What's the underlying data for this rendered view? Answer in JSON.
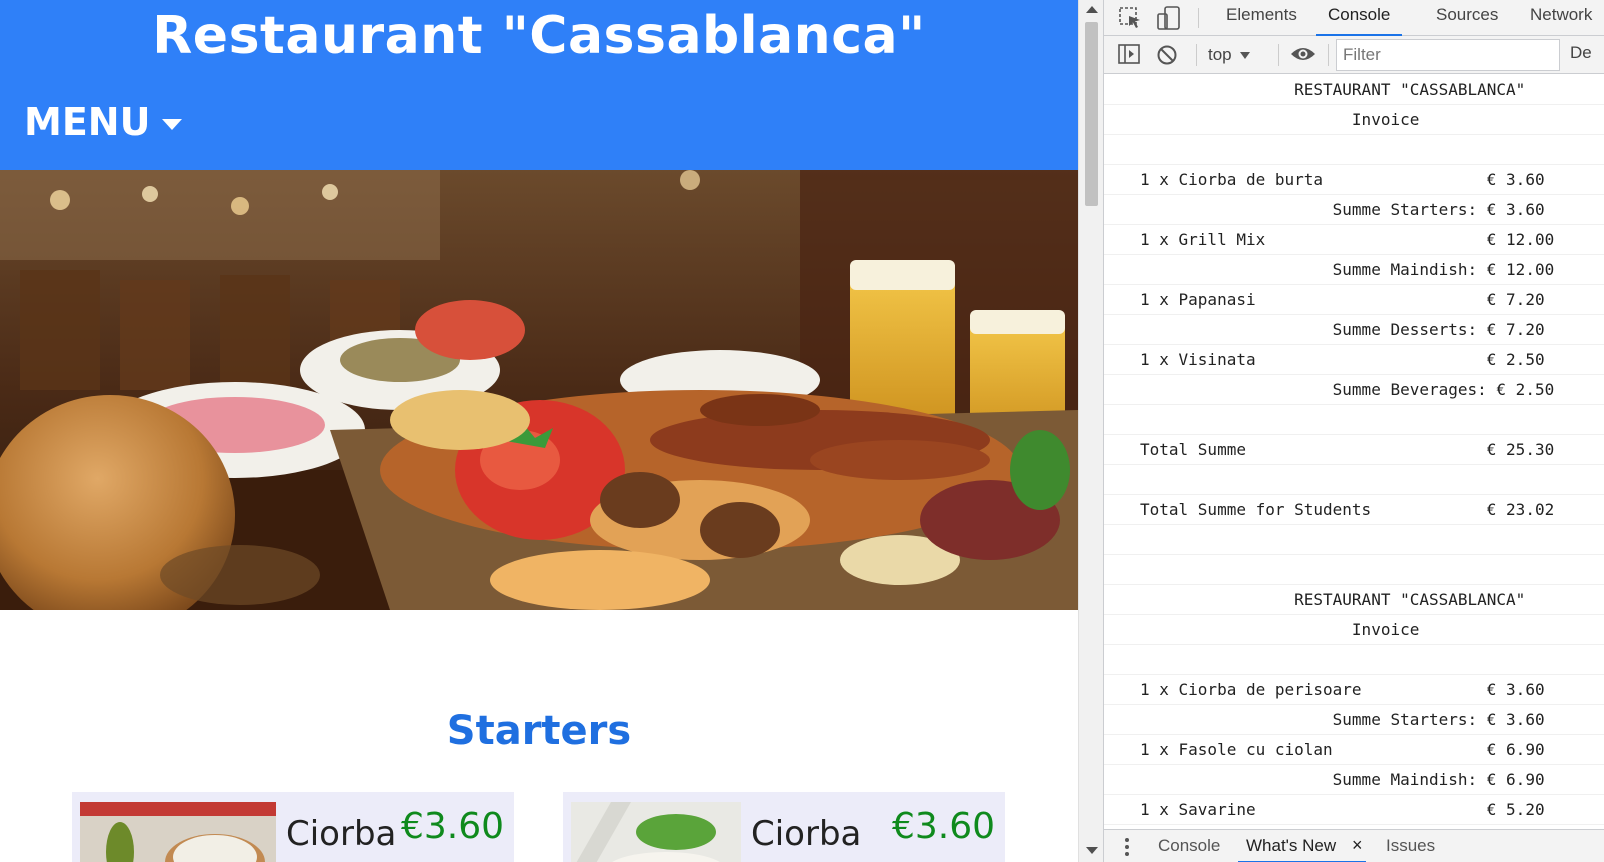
{
  "site": {
    "title": "Restaurant \"Cassablanca\"",
    "menu_label": "MENU",
    "section_title": "Starters",
    "cards": [
      {
        "name": "Ciorba",
        "price": "€3.60"
      },
      {
        "name": "Ciorba",
        "price": "€3.60"
      }
    ],
    "colors": {
      "header_bg": "#2f80f8",
      "section_title": "#1f6fe0",
      "price": "#0f8a1d",
      "card_bg": "#ececf9"
    }
  },
  "devtools": {
    "tabs": [
      "Elements",
      "Console",
      "Sources",
      "Network"
    ],
    "active_tab": "Console",
    "context": "top",
    "filter_placeholder": "Filter",
    "levels_label": "De",
    "drawer": {
      "console": "Console",
      "whats_new": "What's New",
      "close": "×",
      "issues": "Issues"
    },
    "console_lines": [
      "                RESTAURANT \"CASSABLANCA\"",
      "                      Invoice",
      "",
      "1 x Ciorba de burta                 € 3.60",
      "                    Summe Starters: € 3.60",
      "1 x Grill Mix                       € 12.00",
      "                    Summe Maindish: € 12.00",
      "1 x Papanasi                        € 7.20",
      "                    Summe Desserts: € 7.20",
      "1 x Visinata                        € 2.50",
      "                    Summe Beverages: € 2.50",
      "",
      "Total Summe                         € 25.30",
      "",
      "Total Summe for Students            € 23.02",
      "",
      "",
      "                RESTAURANT \"CASSABLANCA\"",
      "                      Invoice",
      "",
      "1 x Ciorba de perisoare             € 3.60",
      "                    Summe Starters: € 3.60",
      "1 x Fasole cu ciolan                € 6.90",
      "                    Summe Maindish: € 6.90",
      "1 x Savarine                        € 5.20"
    ]
  }
}
